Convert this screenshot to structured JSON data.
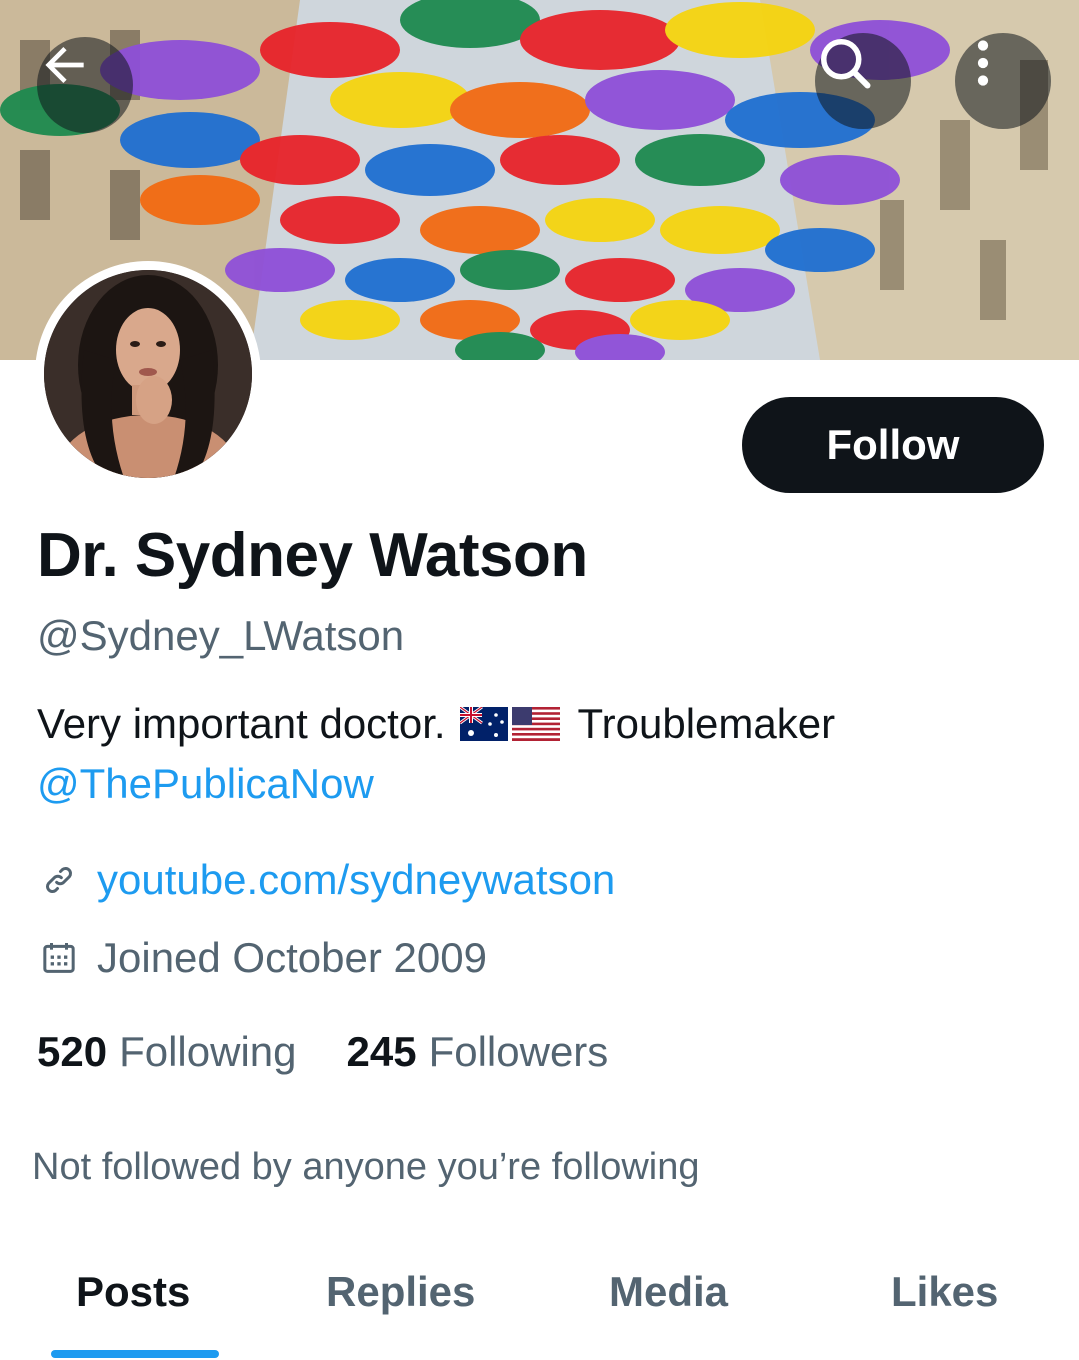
{
  "header": {
    "back_icon": "arrow-left-icon",
    "search_icon": "search-icon",
    "more_icon": "more-vertical-icon"
  },
  "banner": {
    "description_icon": "umbrella-street-banner",
    "umbrella_colors": [
      "#e8232a",
      "#f5d40f",
      "#1f6fd1",
      "#8e4fd8",
      "#1e8a4f",
      "#f26a12"
    ]
  },
  "profile": {
    "display_name": "Dr. Sydney Watson",
    "handle": "@Sydney_LWatson",
    "bio_text": "Very important doctor.",
    "bio_flags": [
      "australia-flag",
      "usa-flag"
    ],
    "bio_suffix": "Troublemaker",
    "bio_mention": "@ThePublicaNow",
    "website": "youtube.com/sydneywatson",
    "joined": "Joined October 2009"
  },
  "actions": {
    "follow_label": "Follow"
  },
  "stats": {
    "following_count": "520",
    "following_label": "Following",
    "followers_count": "245",
    "followers_label": "Followers"
  },
  "social_context": "Not followed by anyone you’re following",
  "tabs": [
    {
      "label": "Posts",
      "active": true
    },
    {
      "label": "Replies",
      "active": false
    },
    {
      "label": "Media",
      "active": false
    },
    {
      "label": "Likes",
      "active": false
    }
  ],
  "colors": {
    "accent": "#1d9bf0",
    "text_primary": "#0f1419",
    "text_secondary": "#536471"
  }
}
